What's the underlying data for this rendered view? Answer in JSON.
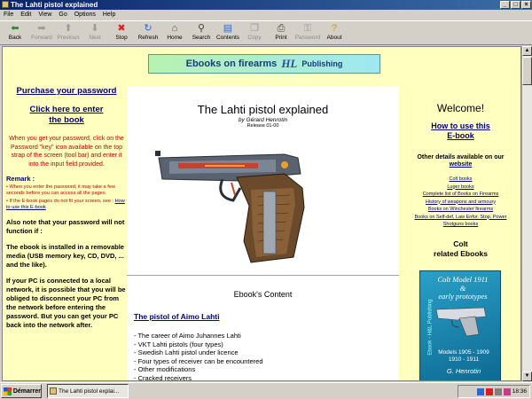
{
  "window": {
    "title": "The Lahti pistol explained"
  },
  "menu": [
    "File",
    "Edit",
    "View",
    "Go",
    "Options",
    "Help"
  ],
  "toolbar": [
    {
      "label": "Back",
      "icon": "back-arrow-icon",
      "glyph": "⬅",
      "color": "#2a8a2a",
      "enabled": true
    },
    {
      "label": "Forward",
      "icon": "forward-arrow-icon",
      "glyph": "➡",
      "color": "#9a9a9a",
      "enabled": false
    },
    {
      "label": "Previous",
      "icon": "up-arrow-icon",
      "glyph": "⬆",
      "color": "#9a9a9a",
      "enabled": false
    },
    {
      "label": "Next",
      "icon": "down-arrow-icon",
      "glyph": "⬇",
      "color": "#9a9a9a",
      "enabled": false
    },
    {
      "label": "Stop",
      "icon": "stop-icon",
      "glyph": "✖",
      "color": "#d82020",
      "enabled": true
    },
    {
      "label": "Refresh",
      "icon": "refresh-icon",
      "glyph": "↻",
      "color": "#2a6ad8",
      "enabled": true
    },
    {
      "label": "Home",
      "icon": "home-icon",
      "glyph": "⌂",
      "color": "#6a4a2a",
      "enabled": true
    },
    {
      "label": "Search",
      "icon": "search-icon",
      "glyph": "⚲",
      "color": "#404040",
      "enabled": true
    },
    {
      "label": "Contents",
      "icon": "contents-icon",
      "glyph": "▤",
      "color": "#2a6ad8",
      "enabled": true
    },
    {
      "label": "Copy",
      "icon": "copy-icon",
      "glyph": "❐",
      "color": "#9a9a9a",
      "enabled": false
    },
    {
      "label": "Print",
      "icon": "print-icon",
      "glyph": "⎙",
      "color": "#404040",
      "enabled": true
    },
    {
      "label": "Password",
      "icon": "password-key-icon",
      "glyph": "⚿",
      "color": "#9a9a9a",
      "enabled": false
    },
    {
      "label": "About",
      "icon": "about-icon",
      "glyph": "?",
      "color": "#c8a000",
      "enabled": true
    }
  ],
  "banner": {
    "part1": "Ebooks on firearms",
    "part2": "HL",
    "part3": "Publishing"
  },
  "left": {
    "purchase": "Purchase your password",
    "enter_line1": "Click here to enter",
    "enter_line2": "the book",
    "instructions": "When you get your password, click on the Password \"key\" icon available on the top strap of the screen (tool bar) and enter it into the input field provided.",
    "remark_title": "Remark :",
    "remark1": "When you enter the password, it may take a few seconds before you can access all the pages.",
    "remark2_pre": "If the E-book pages do not fit your screen, see :",
    "remark2_link": "How to use this E-book",
    "note": "Also note that your password will not function if :",
    "para1": "The ebook is installed in a removable media (USB memory key, CD, DVD, ... and the like).",
    "para2": "If your PC is connected to a local network, it is possible that you will be obliged to disconnect your PC from the network before entering the password. But you can get your PC back into the network after."
  },
  "center": {
    "title": "The Lahti pistol explained",
    "author": "by Gérard Henrotin",
    "release": "Release 01-00",
    "content_title": "Ebook's Content",
    "section_link": "The pistol of Aimo Lahti",
    "items": [
      "- The career of Aimo Juhannes Lahti",
      "- VKT Lahti pistols (four types)",
      "- Swedish Lahti pistol under licence",
      "- Four types of receiver can be encountered",
      "- Other modifications",
      "- Cracked receivers"
    ]
  },
  "right": {
    "welcome": "Welcome!",
    "how_line1": "How to use this",
    "how_line2": "E-book",
    "other": "Other details available on our",
    "website": "website",
    "links": [
      "Colt books",
      "Luger books",
      "Complete list of Books on Firearms",
      "History of weapons and armoury",
      "Books on Winchester firearms",
      "Books on Self-def, Law Enfor. Stop. Power",
      "Shotguns books"
    ],
    "colt_line1": "Colt",
    "colt_line2": "related Ebooks",
    "cover": {
      "title_line1": "Colt Model 1911",
      "title_line2": "&",
      "title_line3": "early prototypes",
      "side": "Ebook - H&L Publishing",
      "years_line1": "Models 1905 - 1909",
      "years_line2": "1910 - 1911",
      "author": "G. Henrotin"
    }
  },
  "taskbar": {
    "start": "Démarrer",
    "task": "The Lahti pistol explai...",
    "clock": "18:36"
  },
  "colors": {
    "page_bg": "#ffffc0",
    "link": "#000080",
    "warning": "#c00000",
    "title_bar": "#0a246a"
  }
}
